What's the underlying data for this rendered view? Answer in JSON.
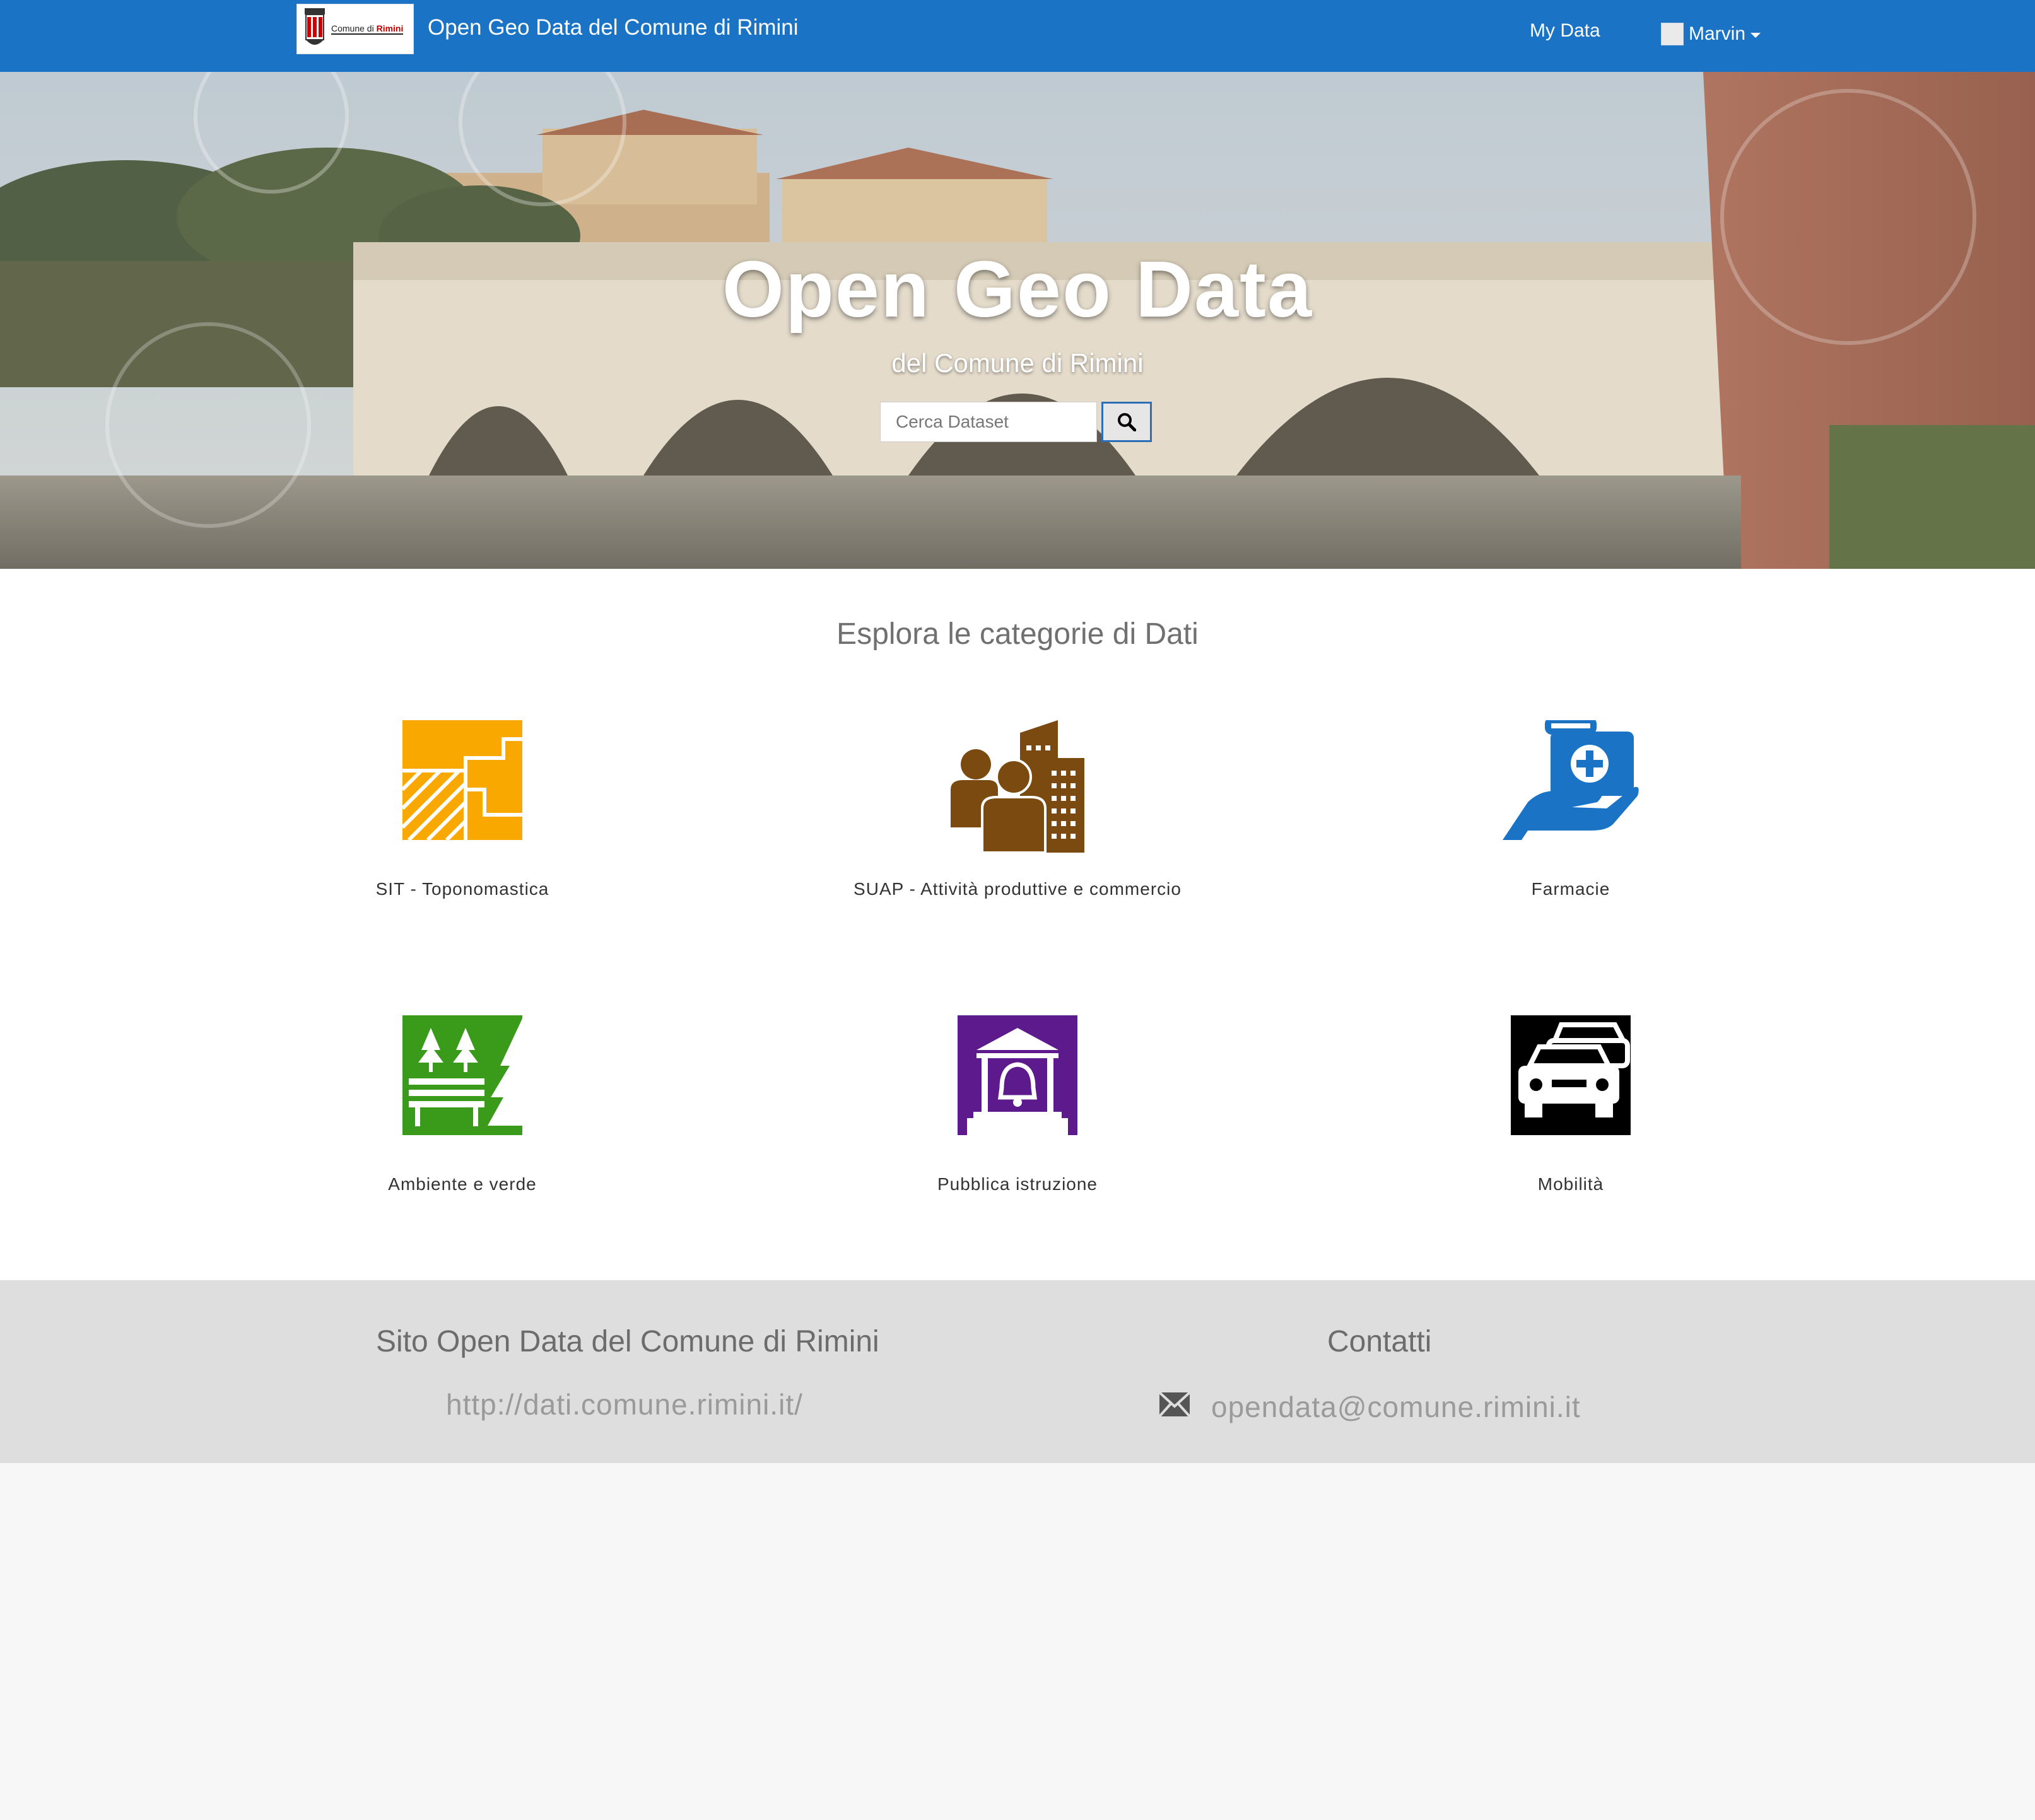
{
  "navbar": {
    "logo_text_prefix": "Comune di ",
    "logo_text_bold": "Rimini",
    "site_title": "Open Geo Data del Comune di Rimini",
    "my_data_label": "My Data",
    "user_name": "Marvin",
    "accent_color": "#1a73c5"
  },
  "hero": {
    "title": "Open Geo Data",
    "subtitle": "del Comune di Rimini",
    "search_placeholder": "Cerca Dataset",
    "search_icon": "search-icon"
  },
  "categories": {
    "heading": "Esplora le categorie di Dati",
    "items": [
      {
        "label": "SIT - Toponomastica",
        "icon": "map-parcels-icon",
        "color": "#f9a800"
      },
      {
        "label": "SUAP - Attività produttive e commercio",
        "icon": "people-buildings-icon",
        "color": "#7a4a10"
      },
      {
        "label": "Farmacie",
        "icon": "medical-kit-hand-icon",
        "color": "#1a73c5"
      },
      {
        "label": "Ambiente e verde",
        "icon": "park-bench-trees-icon",
        "color": "#3a9b1a"
      },
      {
        "label": "Pubblica istruzione",
        "icon": "school-bell-icon",
        "color": "#5c1a8c"
      },
      {
        "label": "Mobilità",
        "icon": "cars-icon",
        "color": "#000000"
      }
    ]
  },
  "footer": {
    "site_title": "Sito Open Data del Comune di Rimini",
    "site_url": "http://dati.comune.rimini.it/",
    "contacts_title": "Contatti",
    "email": "opendata@comune.rimini.it",
    "mail_icon": "envelope-icon"
  }
}
